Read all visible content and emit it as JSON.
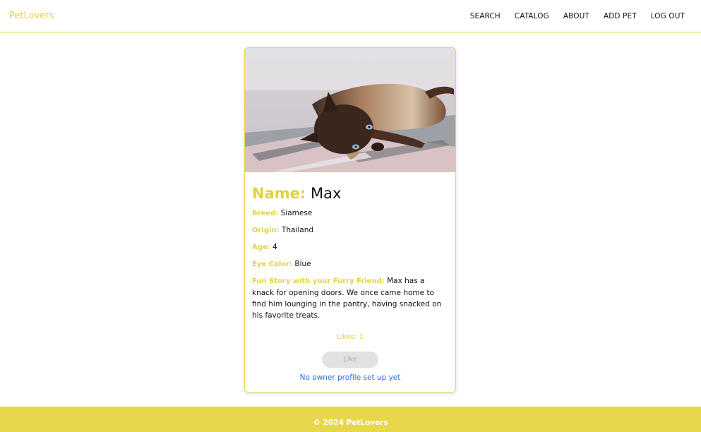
{
  "nav": {
    "brand": "PetLovers",
    "links": [
      "SEARCH",
      "CATALOG",
      "ABOUT",
      "ADD PET",
      "LOG OUT"
    ]
  },
  "pet": {
    "photo_icon": "cat-photo",
    "name_label": "Name:",
    "name": "Max",
    "fields": [
      {
        "label": "Breed:",
        "value": "Siamese"
      },
      {
        "label": "Origin:",
        "value": "Thailand"
      },
      {
        "label": "Age:",
        "value": "4"
      },
      {
        "label": "Eye Color:",
        "value": "Blue"
      },
      {
        "label": "Fun Story with your Furry Friend:",
        "value": "Max has a knack for opening doors. We once came home to find him lounging in the pantry, having snacked on his favorite treats."
      }
    ],
    "likes": "Likes: 1",
    "like_button": "Like",
    "owner_link": "No owner profile set up yet"
  },
  "footer": {
    "text": "© 2024 PetLovers"
  },
  "colors": {
    "accent": "#e6d84a",
    "link": "#2b6fd6"
  }
}
